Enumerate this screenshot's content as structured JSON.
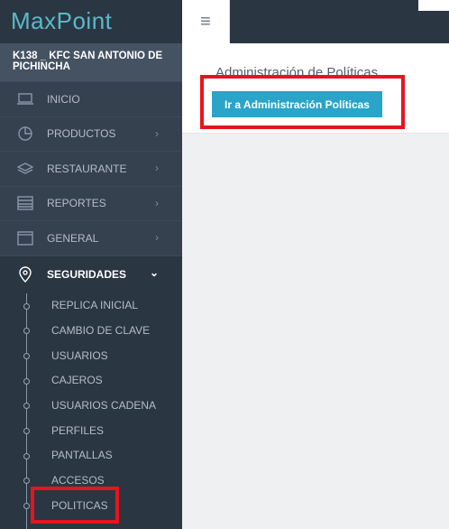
{
  "brand": {
    "logo_part1": "Max",
    "logo_part2": "Point"
  },
  "store": {
    "name": "K138 _ KFC SAN ANTONIO DE PICHINCHA"
  },
  "menu": [
    {
      "label": "INICIO",
      "icon": "laptop-icon"
    },
    {
      "label": "PRODUCTOS",
      "icon": "pie-chart-icon"
    },
    {
      "label": "RESTAURANTE",
      "icon": "layers-icon"
    },
    {
      "label": "REPORTES",
      "icon": "table-icon"
    },
    {
      "label": "GENERAL",
      "icon": "window-icon"
    }
  ],
  "security": {
    "label": "SEGURIDADES",
    "icon": "map-pin-icon",
    "items": [
      "REPLICA INICIAL",
      "CAMBIO DE CLAVE",
      "USUARIOS",
      "CAJEROS",
      "USUARIOS CADENA",
      "PERFILES",
      "PANTALLAS",
      "ACCESOS",
      "POLITICAS"
    ]
  },
  "header": {
    "toggle_icon": "≡"
  },
  "main": {
    "title": "Administración de Políticas",
    "button": "Ir a Administración Políticas"
  },
  "colors": {
    "accent": "#2aa4c8",
    "highlight": "#e8141c",
    "sidebar": "#364150"
  }
}
